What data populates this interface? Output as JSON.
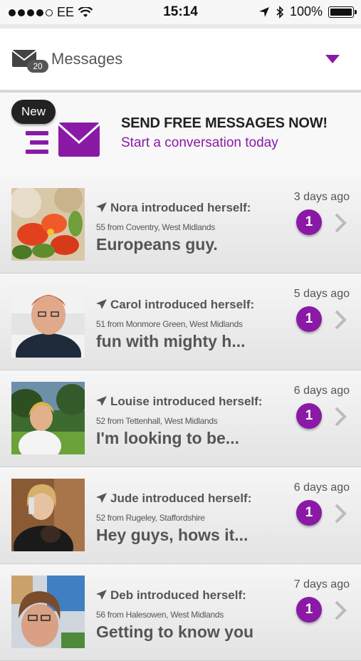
{
  "status_bar": {
    "carrier": "EE",
    "time": "15:14",
    "battery": "100%"
  },
  "header": {
    "message_count": "20",
    "title": "Messages"
  },
  "promo": {
    "badge": "New",
    "headline": "SEND FREE MESSAGES NOW!",
    "subtitle": "Start a conversation today"
  },
  "messages": [
    {
      "name": "Nora introduced herself:",
      "location": "55 from Coventry, West Midlands",
      "preview": "Europeans guy.",
      "time": "3 days ago",
      "unread": "1"
    },
    {
      "name": "Carol introduced herself:",
      "location": "51 from Monmore Green, West Midlands",
      "preview": "fun with mighty h...",
      "time": "5 days ago",
      "unread": "1"
    },
    {
      "name": "Louise introduced herself:",
      "location": "52 from Tettenhall, West Midlands",
      "preview": "I'm looking to be...",
      "time": "6 days ago",
      "unread": "1"
    },
    {
      "name": "Jude introduced herself:",
      "location": "52 from Rugeley, Staffordshire",
      "preview": "Hey guys, hows it...",
      "time": "6 days ago",
      "unread": "1"
    },
    {
      "name": "Deb introduced herself:",
      "location": "56 from Halesowen, West Midlands",
      "preview": "Getting to know you",
      "time": "7 days ago",
      "unread": "1"
    }
  ],
  "colors": {
    "accent": "#8a1aa6",
    "text": "#555555"
  }
}
